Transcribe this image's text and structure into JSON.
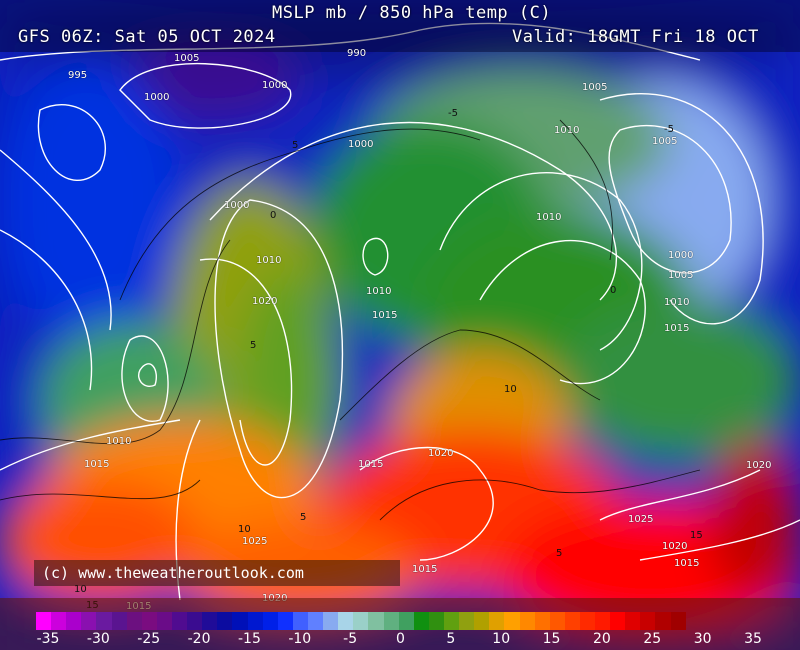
{
  "header": {
    "title": "MSLP mb / 850 hPa temp (C)",
    "run": "GFS 06Z: Sat 05 OCT 2024",
    "valid": "Valid: 18GMT Fri 18 OCT"
  },
  "credit": "(c) www.theweatheroutlook.com",
  "isobar_labels": [
    "995",
    "1005",
    "1000",
    "1000",
    "990",
    "1000",
    "1000",
    "1010",
    "1005",
    "1005",
    "1000",
    "1010",
    "1020",
    "1010",
    "1015",
    "1010",
    "1020",
    "1000",
    "1005",
    "1010",
    "1015",
    "1010",
    "1015",
    "1020",
    "1025",
    "1025",
    "1015",
    "1020",
    "1015",
    "1020",
    "1015",
    "1020",
    "1015"
  ],
  "temp_labels": [
    "-5",
    "5",
    "0",
    "0",
    "-5",
    "5",
    "10",
    "10",
    "5",
    "15",
    "5",
    "10",
    "15"
  ],
  "colorbar": {
    "ticks": [
      "-35",
      "-30",
      "-25",
      "-20",
      "-15",
      "-10",
      "-5",
      "0",
      "5",
      "10",
      "15",
      "20",
      "25",
      "30",
      "35"
    ],
    "colors": [
      "#ff00ff",
      "#cc00dd",
      "#aa00cc",
      "#8a10b0",
      "#6a1aa0",
      "#5a1490",
      "#6c1080",
      "#7a0c80",
      "#6a0c88",
      "#500c90",
      "#3a0c90",
      "#200c98",
      "#0c0ca0",
      "#0010b8",
      "#0018d0",
      "#0020e8",
      "#1030ff",
      "#4060ff",
      "#6080ff",
      "#88aaf0",
      "#a8d4e8",
      "#9ad0c8",
      "#80c0a0",
      "#60b080",
      "#40a060",
      "#109010",
      "#309010",
      "#60a010",
      "#90a010",
      "#b0a000",
      "#e0a000",
      "#ffa000",
      "#ff8800",
      "#ff7000",
      "#ff5800",
      "#ff4000",
      "#ff2a00",
      "#ff1a00",
      "#ff0000",
      "#e00000",
      "#c80000",
      "#b00000",
      "#a00000"
    ],
    "range": [
      -35,
      35
    ],
    "unit": "C"
  }
}
